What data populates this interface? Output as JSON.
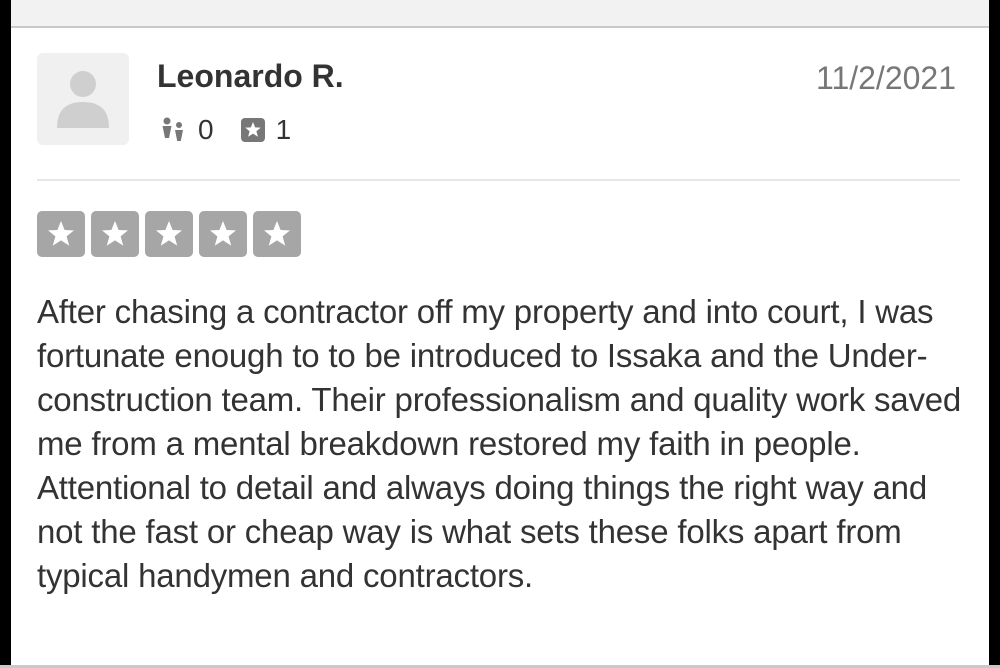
{
  "review": {
    "author": "Leonardo R.",
    "date": "11/2/2021",
    "stats": {
      "friends_icon": "friends-icon",
      "friends_count": "0",
      "reviews_icon": "review-star-icon",
      "reviews_count": "1"
    },
    "rating": {
      "value": 5,
      "max": 5,
      "star_color": "#a6a6a6"
    },
    "text": "After chasing a contractor off my property and into court, I was fortunate enough to to be introduced to Issaka and the Under-construction team. Their professionalism and quality work saved me from a mental breakdown restored my faith in people. Attentional to detail and always doing things the right way and not the fast or cheap way is what sets these folks apart from typical handymen and contractors."
  }
}
